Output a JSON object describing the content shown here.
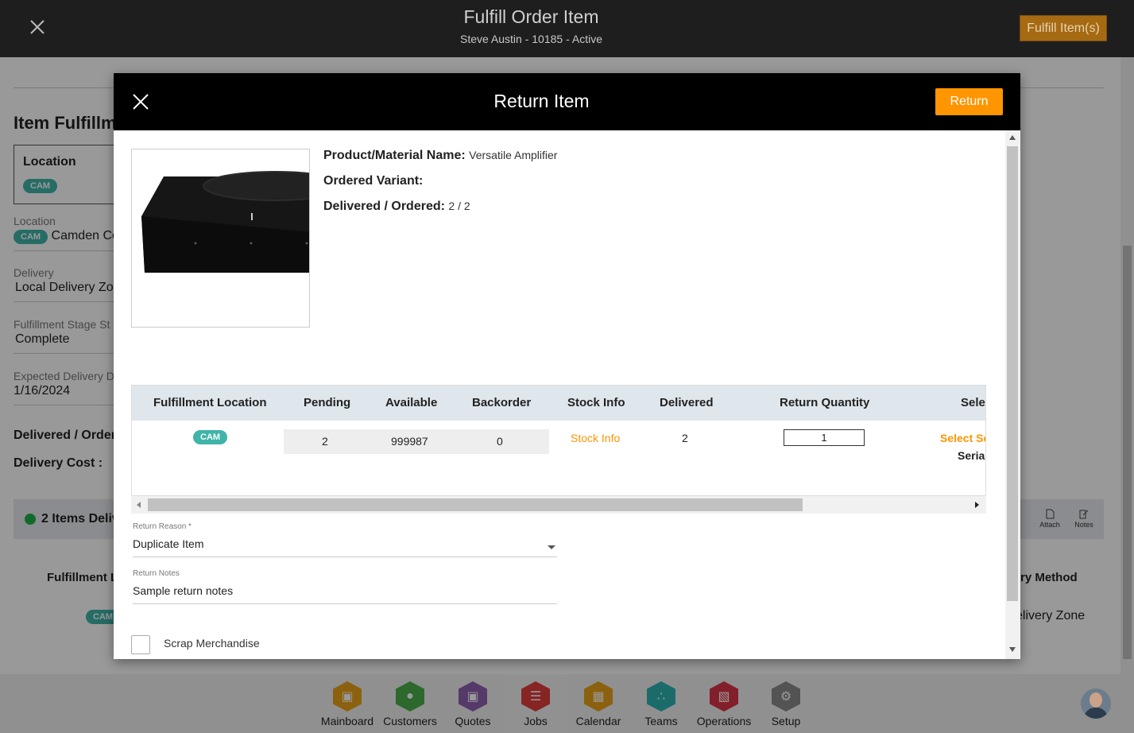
{
  "header": {
    "title": "Fulfill Order Item",
    "subtitle": "Steve Austin - 10185 - Active",
    "fulfill_button": "Fulfill Item(s)"
  },
  "background_page": {
    "heading": "Item Fulfillm",
    "location_box_label": "Location",
    "location_chip": "CAM",
    "location_label": "Location",
    "location_chip2": "CAM",
    "location_value": "Camden Co",
    "delivery_label": "Delivery",
    "delivery_value": "Local Delivery Zo",
    "stage_label": "Fulfillment Stage St",
    "stage_value": "Complete",
    "expected_label": "Expected Delivery D",
    "expected_value": "1/16/2024",
    "delivered_ordered": "Delivered / Order",
    "delivery_cost": "Delivery Cost :",
    "band_text": "2 Items Deliv",
    "attach_label": "Attach",
    "notes_label": "Notes",
    "col_fulfillment": "Fulfillment L",
    "col_method": "ry Method",
    "row_chip": "CAM",
    "row_method": "elivery Zone"
  },
  "modal": {
    "title": "Return Item",
    "return_button": "Return",
    "product_name_label": "Product/Material Name:",
    "product_name_value": "Versatile Amplifier",
    "ordered_variant_label": "Ordered Variant:",
    "delivered_ordered_label": "Delivered / Ordered:",
    "delivered_ordered_value": "2 / 2",
    "table": {
      "headers": [
        "Fulfillment Location",
        "Pending",
        "Available",
        "Backorder",
        "Stock Info",
        "Delivered",
        "Return Quantity",
        "Selec"
      ],
      "row": {
        "location_chip": "CAM",
        "pending": "2",
        "available": "999987",
        "backorder": "0",
        "stock_info": "Stock Info",
        "delivered": "2",
        "return_quantity": "1",
        "select_serial": "Select Se",
        "serial": "Serial"
      }
    },
    "return_reason_label": "Return Reason *",
    "return_reason_value": "Duplicate Item",
    "return_notes_label": "Return Notes",
    "return_notes_value": "Sample return notes",
    "scrap_label": "Scrap Merchandise"
  },
  "bottom_nav": {
    "items": [
      {
        "label": "Mainboard",
        "color": "#e8a21c"
      },
      {
        "label": "Customers",
        "color": "#4cae4c"
      },
      {
        "label": "Quotes",
        "color": "#8e5fb0"
      },
      {
        "label": "Jobs",
        "color": "#e23c3c"
      },
      {
        "label": "Calendar",
        "color": "#e8a21c"
      },
      {
        "label": "Teams",
        "color": "#2fb3b3"
      },
      {
        "label": "Operations",
        "color": "#d93548"
      },
      {
        "label": "Setup",
        "color": "#8a8a8a"
      }
    ],
    "active": "Jobs"
  },
  "colors": {
    "accent": "#ff9500",
    "chip": "#3fb4a8",
    "status_green": "#1db344"
  }
}
